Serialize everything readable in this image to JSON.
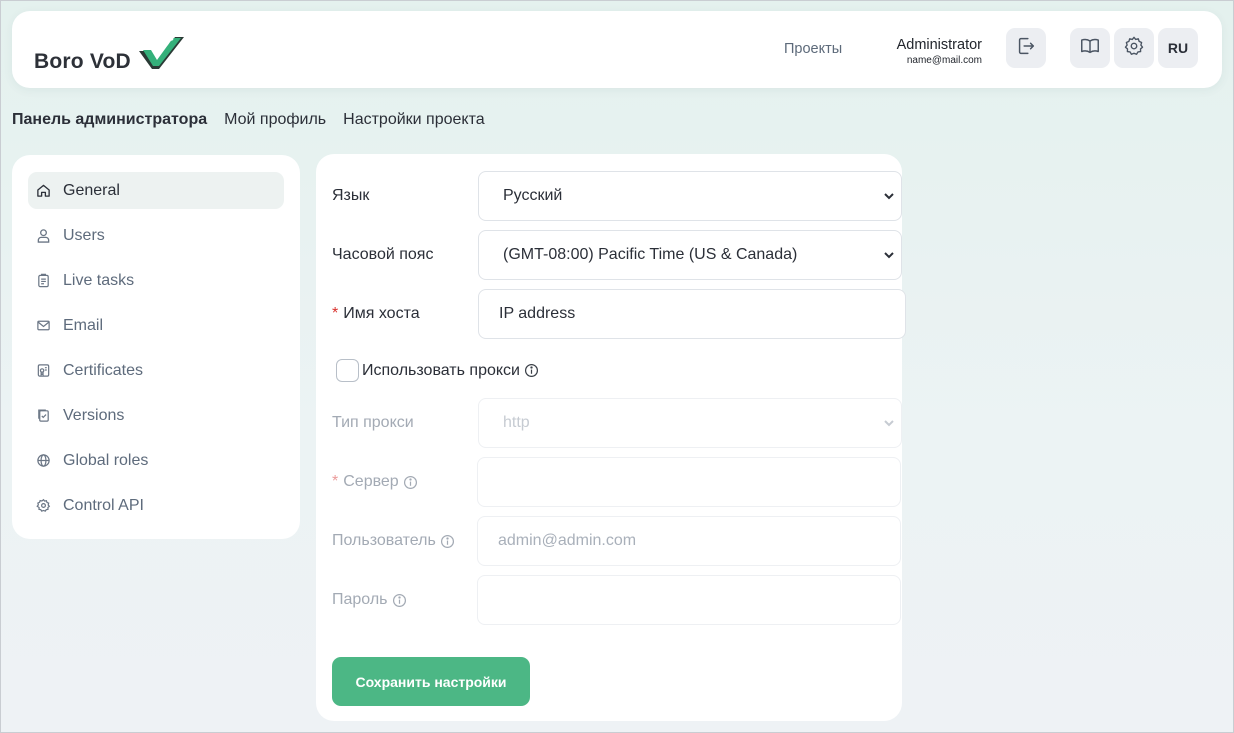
{
  "app": {
    "logo_text": "Boro VoD"
  },
  "header": {
    "projects_link": "Проекты",
    "user_name": "Administrator",
    "user_email": "name@mail.com",
    "lang_button": "RU"
  },
  "tabs": [
    {
      "label": "Панель администратора",
      "active": true
    },
    {
      "label": "Мой профиль"
    },
    {
      "label": "Настройки проекта"
    }
  ],
  "sidebar": {
    "items": [
      {
        "label": "General",
        "icon": "home-icon",
        "active": true
      },
      {
        "label": "Users",
        "icon": "user-icon"
      },
      {
        "label": "Live tasks",
        "icon": "clipboard-icon"
      },
      {
        "label": "Email",
        "icon": "mail-icon"
      },
      {
        "label": "Certificates",
        "icon": "certificate-icon"
      },
      {
        "label": "Versions",
        "icon": "versions-icon"
      },
      {
        "label": "Global roles",
        "icon": "globe-icon"
      },
      {
        "label": "Control API",
        "icon": "gear-icon"
      }
    ]
  },
  "form": {
    "language_label": "Язык",
    "language_value": "Русский",
    "timezone_label": "Часовой пояс",
    "timezone_value": "(GMT-08:00) Pacific Time (US & Canada)",
    "hostname_required": "*",
    "hostname_label": "Имя хоста",
    "hostname_value": "IP address",
    "use_proxy_label": "Использовать прокси",
    "use_proxy_checked": false,
    "proxy_type_label": "Тип прокси",
    "proxy_type_value": "http",
    "server_required": "*",
    "server_label": "Сервер",
    "server_value": "",
    "user_label": "Пользователь",
    "user_placeholder": "admin@admin.com",
    "password_label": "Пароль",
    "password_value": "",
    "save_button": "Сохранить настройки"
  },
  "colors": {
    "accent": "#4cb785",
    "logo_green": "#2fa874",
    "required": "#d9302c",
    "text": "#2b2f38",
    "muted": "#5e6b7c"
  }
}
